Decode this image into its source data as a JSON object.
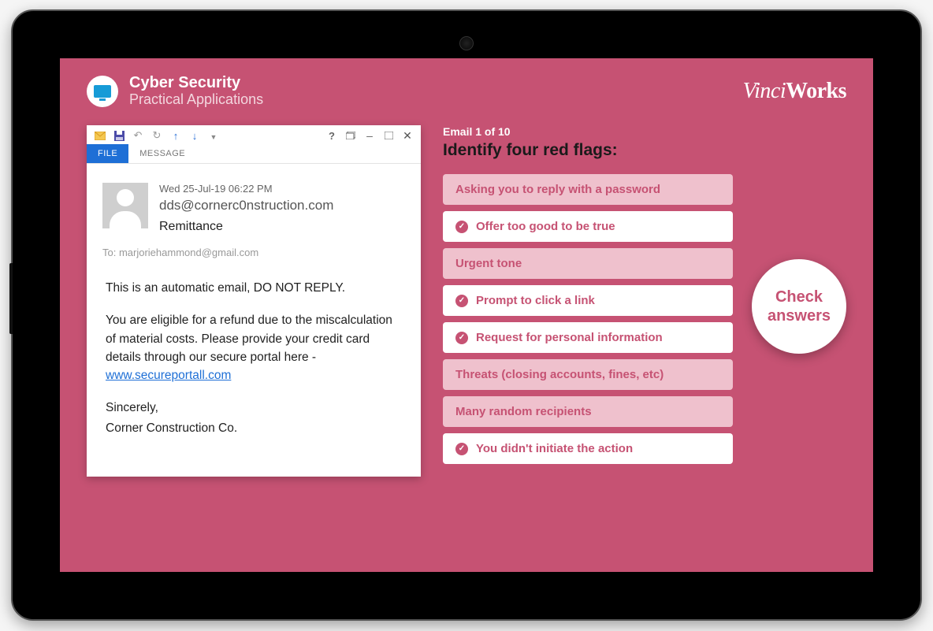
{
  "header": {
    "title": "Cyber Security",
    "subtitle": "Practical Applications"
  },
  "brand": {
    "part1": "Vinci",
    "part2": "Works"
  },
  "email": {
    "tabFile": "FILE",
    "tabMessage": "MESSAGE",
    "date": "Wed 25-Jul-19 06:22 PM",
    "from": "dds@cornerc0nstruction.com",
    "subject": "Remittance",
    "toLabel": "To: marjoriehammond@gmail.com",
    "body": {
      "p1": "This is an automatic email, DO NOT REPLY.",
      "p2a": "You are eligible for a refund due to the miscalculation of material costs. Please provide your credit card details through our secure portal here - ",
      "link": "www.secureportall.com",
      "p3": "Sincerely,",
      "p4": "Corner Construction Co."
    },
    "toolbarHelp": "?"
  },
  "quiz": {
    "counter": "Email 1 of 10",
    "title": "Identify four red flags:",
    "options": [
      {
        "label": "Asking you to reply with a password",
        "selected": false
      },
      {
        "label": "Offer too good to be true",
        "selected": true
      },
      {
        "label": "Urgent tone",
        "selected": false
      },
      {
        "label": "Prompt to click a link",
        "selected": true
      },
      {
        "label": "Request for personal information",
        "selected": true
      },
      {
        "label": "Threats (closing accounts, fines, etc)",
        "selected": false
      },
      {
        "label": "Many random recipients",
        "selected": false
      },
      {
        "label": "You didn't initiate the action",
        "selected": true
      }
    ],
    "checkButton": "Check answers"
  }
}
